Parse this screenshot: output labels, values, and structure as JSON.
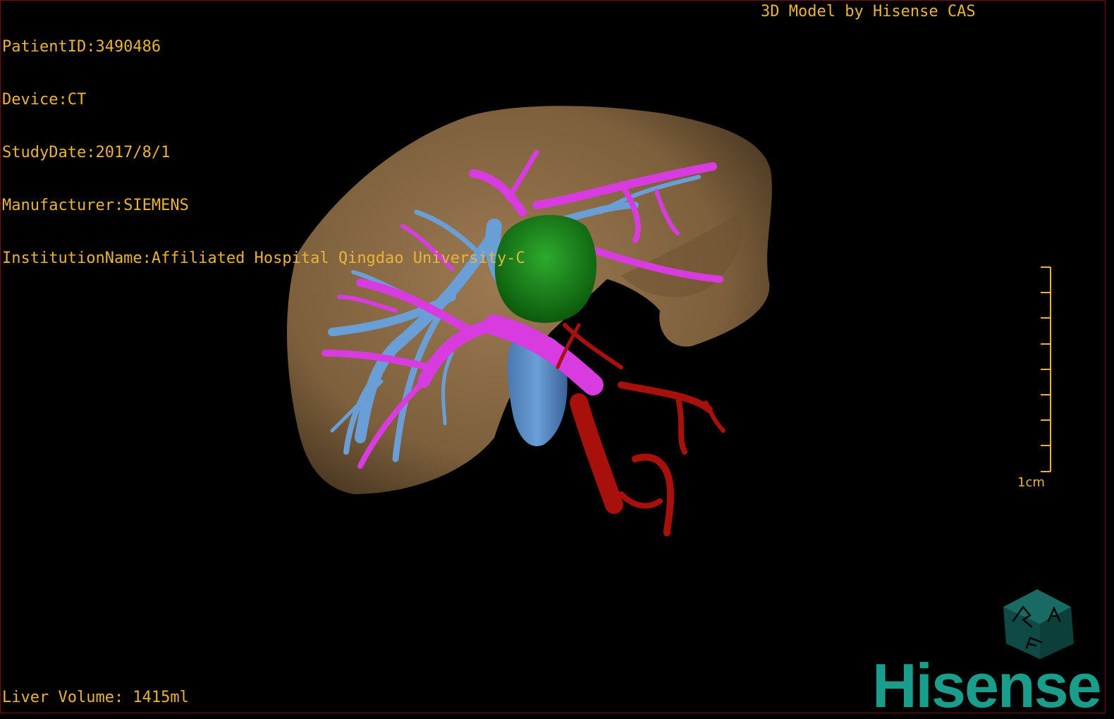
{
  "overlay": {
    "patient_id": "PatientID:3490486",
    "device": "Device:CT",
    "study_date": "StudyDate:2017/8/1",
    "manufacturer": "Manufacturer:SIEMENS",
    "institution": "InstitutionName:Affiliated Hospital Qingdao University-C",
    "credit": "3D Model by Hisense CAS",
    "liver_volume": "Liver Volume: 1415ml"
  },
  "scale_bar": {
    "label": "1cm"
  },
  "orientation_cube": {
    "face_letters": [
      "R",
      "A",
      "F"
    ]
  },
  "brand": {
    "name": "Hisense"
  },
  "colors": {
    "overlay_text": "#e8b43a",
    "liver": "#8a6a44",
    "portal_vein": "#d83ce0",
    "hepatic_vein": "#6a9ed6",
    "tumor": "#1e8a1e",
    "artery": "#a8100c",
    "brand": "#1a9e8c"
  },
  "icons": {
    "orientation": "orientation-cube-icon"
  }
}
